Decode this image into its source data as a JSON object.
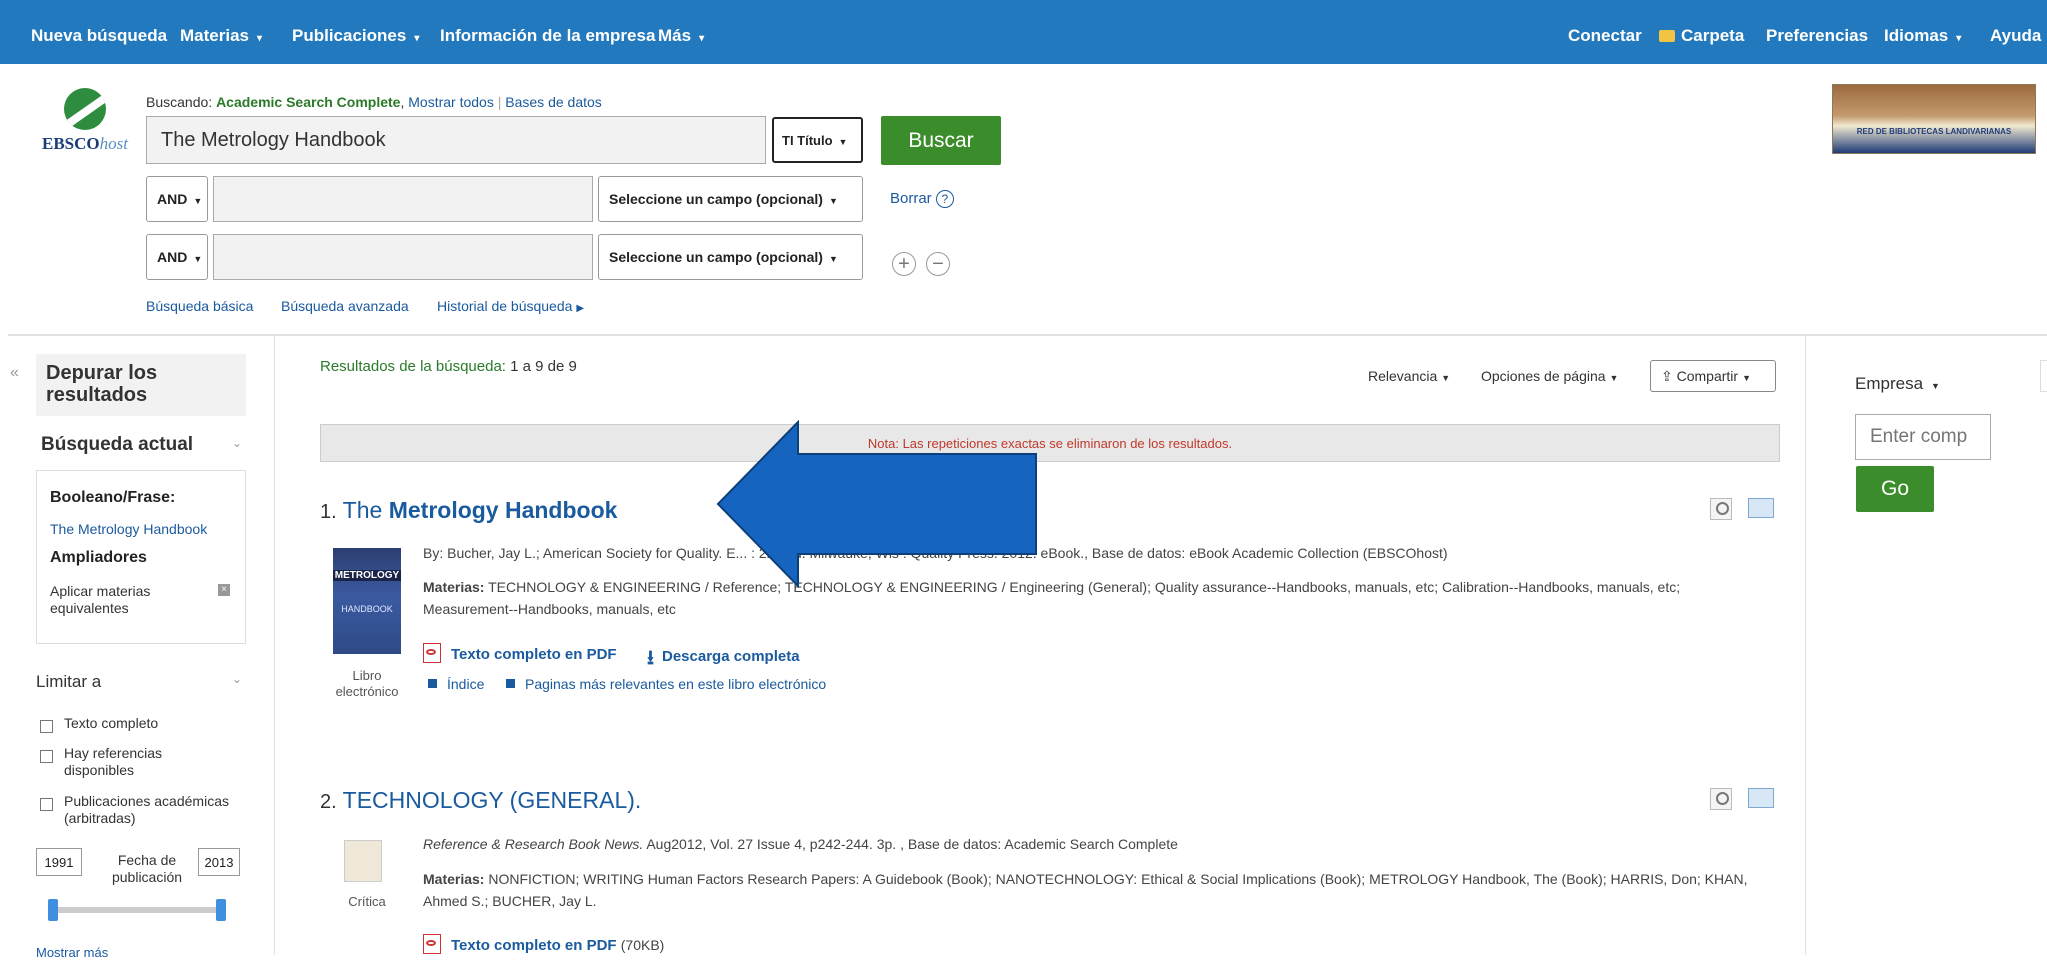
{
  "nav": {
    "new_search": "Nueva búsqueda",
    "subjects": "Materias",
    "publications": "Publicaciones",
    "company_info": "Información de la empresa",
    "more": "Más",
    "sign_in": "Conectar",
    "folder": "Carpeta",
    "preferences": "Preferencias",
    "languages": "Idiomas",
    "help": "Ayuda"
  },
  "logo": {
    "brand": "EBSCO",
    "suffix": "host"
  },
  "search": {
    "searching_label": "Buscando:",
    "database": "Academic Search Complete",
    "show_all": "Mostrar todos",
    "databases": "Bases de datos",
    "query": "The Metrology Handbook",
    "field1": "TI Título",
    "button": "Buscar",
    "operator2": "AND",
    "field2": "Seleccione un campo (opcional)",
    "operator3": "AND",
    "field3": "Seleccione un campo (opcional)",
    "clear": "Borrar",
    "basic": "Búsqueda básica",
    "advanced": "Búsqueda avanzada",
    "history": "Historial de búsqueda"
  },
  "banner": {
    "text": "RED DE BIBLIOTECAS LANDIVARIANAS"
  },
  "sidebar": {
    "refine": "Depurar los resultados",
    "current_search": "Búsqueda actual",
    "boolean_label": "Booleano/Frase:",
    "boolean_value": "The Metrology Handbook",
    "expanders": "Ampliadores",
    "apply_subjects": "Aplicar materias equivalentes",
    "limit_to": "Limitar a",
    "limits": [
      "Texto completo",
      "Hay referencias disponibles",
      "Publicaciones académicas (arbitradas)"
    ],
    "date_from": "1991",
    "date_label": "Fecha de publicación",
    "date_to": "2013",
    "show_more": "Mostrar más"
  },
  "results": {
    "summary_label": "Resultados de la búsqueda:",
    "summary_value": "1 a 9 de 9",
    "sort": "Relevancia",
    "page_options": "Opciones de página",
    "share": "Compartir",
    "note": "Nota: Las repeticiones exactas se eliminaron de los resultados.",
    "items": [
      {
        "num": "1.",
        "title_pre": "The ",
        "title_bold": "Metrology Handbook",
        "byline": "By: Bucher, Jay L.; American Society for Quality. E... : 2nd ed. Milwauke, Wis : Quality Press. 2012. eBook., Base de datos: eBook Academic Collection (EBSCOhost)",
        "subjects_label": "Materias:",
        "subjects": "TECHNOLOGY & ENGINEERING / Reference; TECHNOLOGY & ENGINEERING / Engineering (General); Quality assurance--Handbooks, manuals, etc; Calibration--Handbooks, manuals, etc; Measurement--Handbooks, manuals, etc",
        "pdf": "Texto completo en PDF",
        "download": "Descarga completa",
        "index": "Índice",
        "pages": "Paginas más relevantes en este libro electrónico",
        "type": "Libro electrónico",
        "cover_title": "METROLOGY",
        "cover_sub": "HANDBOOK"
      },
      {
        "num": "2.",
        "title": "TECHNOLOGY (GENERAL).",
        "source": "Reference & Research Book News.",
        "source_rest": " Aug2012, Vol. 27 Issue 4, p242-244. 3p. , Base de datos: Academic Search Complete",
        "subjects_label": "Materias:",
        "subjects": "NONFICTION; WRITING Human Factors Research Papers: A Guidebook (Book); NANOTECHNOLOGY: Ethical & Social Implications (Book); METROLOGY Handbook, The (Book); HARRIS, Don; KHAN, Ahmed S.; BUCHER, Jay L.",
        "pdf": "Texto completo en PDF",
        "pdf_size": "(70KB)",
        "type": "Crítica"
      }
    ]
  },
  "right": {
    "company": "Empresa",
    "placeholder": "Enter comp",
    "go": "Go"
  },
  "colors": {
    "nav": "#2379bd",
    "green": "#3b8c2a",
    "arrow": "#1565c0"
  }
}
